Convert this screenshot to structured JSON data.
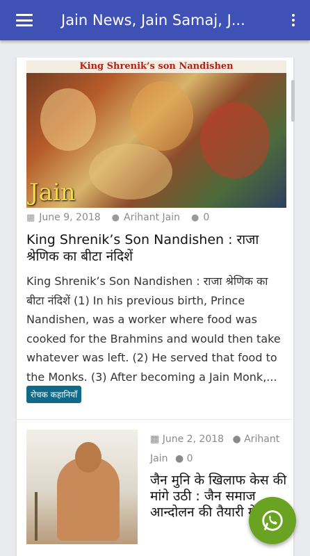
{
  "appbar": {
    "title": "Jain News, Jain Samaj, J..."
  },
  "post1": {
    "image_caption": "King Shrenik’s son Nandishen",
    "logo_text": "Jain",
    "date": "June 9, 2018",
    "author": "Arihant Jain",
    "comments": "0",
    "title": "King Shrenik’s Son Nandishen : राजा श्रेणिक का बीटा नंदिशें",
    "excerpt": "King Shrenik’s Son Nandishen : राजा श्रेणिक का बीटा नंदिशें (1) In his previous birth, Prince Nandishen, was a worker where food was cooked for the Brahmins and would then take whatever was left. (2) He served that food to the Monks. (3) After becoming a Jain Monk,...",
    "category": "रोचक कहानियाँ"
  },
  "post2": {
    "date": "June 2, 2018",
    "author": "Arihant Jain",
    "comments": "0",
    "title": "जैन मुनि के खिलाफ केस की मांगे उठी : जैन समाज आन्दोलन की तैयारी में"
  },
  "colors": {
    "appbar": "#3f51b5",
    "badge": "#0f6a8a",
    "fab": "#6aa321"
  },
  "icons": {
    "menu": "hamburger-icon",
    "more": "overflow-menu-icon",
    "calendar": "calendar-icon",
    "user": "user-icon",
    "comment": "comment-icon",
    "fab": "whatsapp-icon"
  }
}
